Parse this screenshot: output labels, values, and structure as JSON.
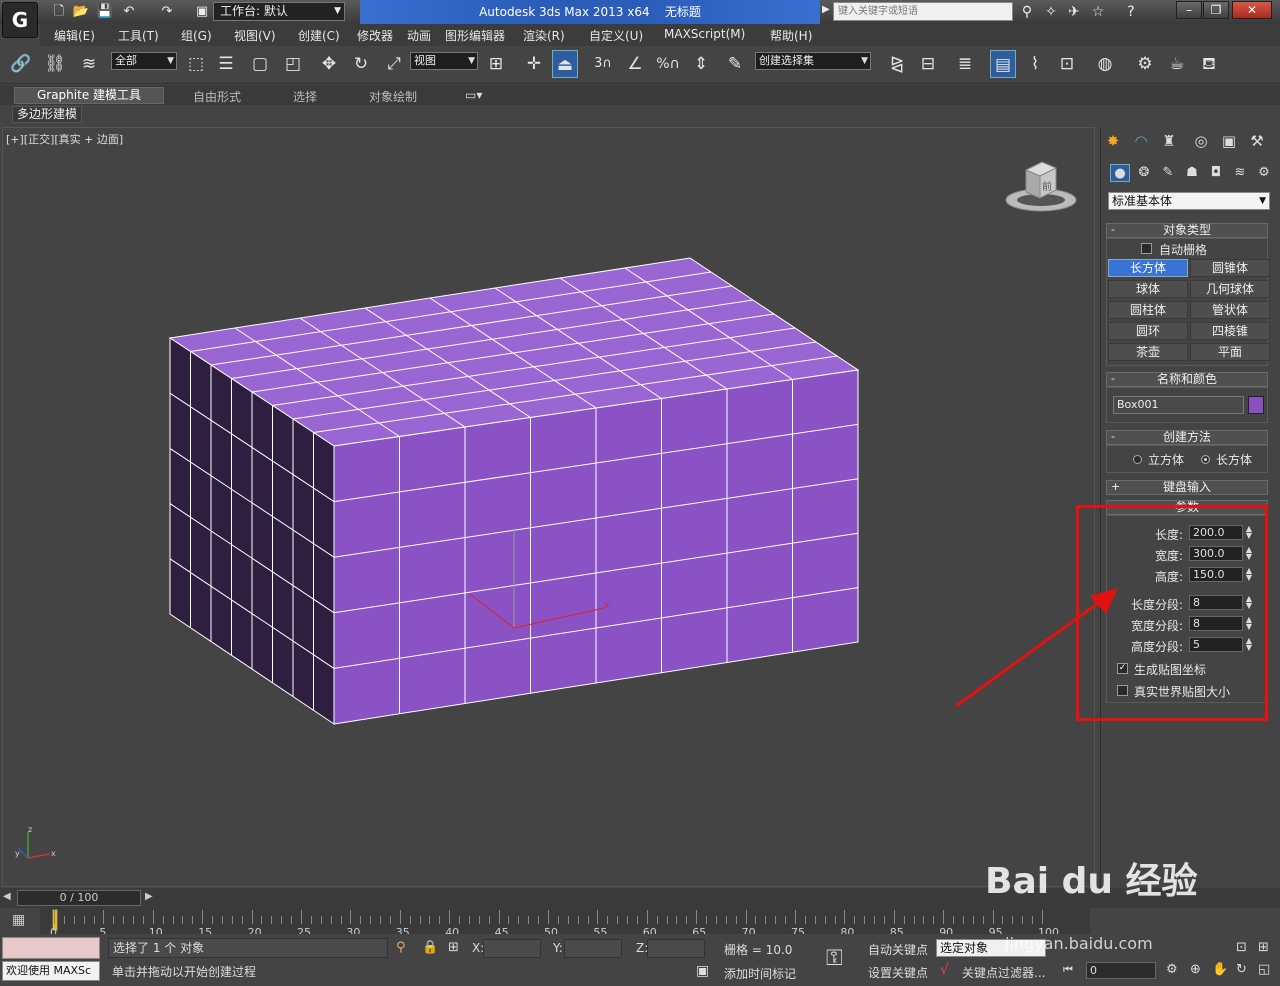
{
  "titlebar": {
    "workspace": "工作台: 默认",
    "app_title": "Autodesk 3ds Max  2013 x64",
    "doc_title": "无标题",
    "search_placeholder": "键入关键字或短语",
    "help_icon": "help-icon"
  },
  "menu": [
    "编辑(E)",
    "工具(T)",
    "组(G)",
    "视图(V)",
    "创建(C)",
    "修改器",
    "动画",
    "图形编辑器",
    "渲染(R)",
    "自定义(U)",
    "MAXScript(M)",
    "帮助(H)"
  ],
  "toolbar": {
    "filter": "全部",
    "ref_coord": "视图",
    "named_sel": "创建选择集",
    "snap3": "3",
    "snap_pct": "%"
  },
  "ribbon": {
    "tabs": [
      "Graphite 建模工具",
      "自由形式",
      "选择",
      "对象绘制"
    ],
    "sub_tab": "多边形建模"
  },
  "viewport": {
    "label": "[+][正交][真实 + 边面]",
    "box_color": "#8a52c4",
    "cube_label": "前"
  },
  "command_panel": {
    "category": "标准基本体",
    "object_type": {
      "header": "对象类型",
      "autogrid": "自动栅格",
      "buttons": [
        "长方体",
        "圆锥体",
        "球体",
        "几何球体",
        "圆柱体",
        "管状体",
        "圆环",
        "四棱锥",
        "茶壶",
        "平面"
      ]
    },
    "name_color": {
      "header": "名称和颜色",
      "name": "Box001",
      "color": "#8a4fc2"
    },
    "creation_method": {
      "header": "创建方法",
      "cube": "立方体",
      "box": "长方体"
    },
    "keyboard_entry": "键盘输入",
    "params": {
      "header": "参数",
      "length_label": "长度:",
      "length": "200.0",
      "width_label": "宽度:",
      "width": "300.0",
      "height_label": "高度:",
      "height": "150.0",
      "length_segs_label": "长度分段:",
      "length_segs": "8",
      "width_segs_label": "宽度分段:",
      "width_segs": "8",
      "height_segs_label": "高度分段:",
      "height_segs": "5",
      "gen_map": "生成贴图坐标",
      "real_world": "真实世界贴图大小"
    }
  },
  "timeline": {
    "slider": "0 / 100",
    "ticks": [
      "0",
      "5",
      "10",
      "15",
      "20",
      "25",
      "30",
      "35",
      "40",
      "45",
      "50",
      "55",
      "60",
      "65",
      "70",
      "75",
      "80",
      "85",
      "90",
      "95",
      "100"
    ]
  },
  "status": {
    "welcome": "欢迎使用 MAXSc",
    "selection": "选择了 1 个 对象",
    "prompt": "单击并拖动以开始创建过程",
    "x": "X:",
    "y": "Y:",
    "z": "Z:",
    "grid": "栅格 = 10.0",
    "add_time_tag": "添加时间标记",
    "auto_key": "自动关键点",
    "sel_filter": "选定对象",
    "set_key": "设置关键点",
    "key_filters": "关键点过滤器...",
    "frame": "0"
  },
  "watermark": {
    "brand": "Bai du 经验",
    "url": "jingyan.baidu.com"
  }
}
